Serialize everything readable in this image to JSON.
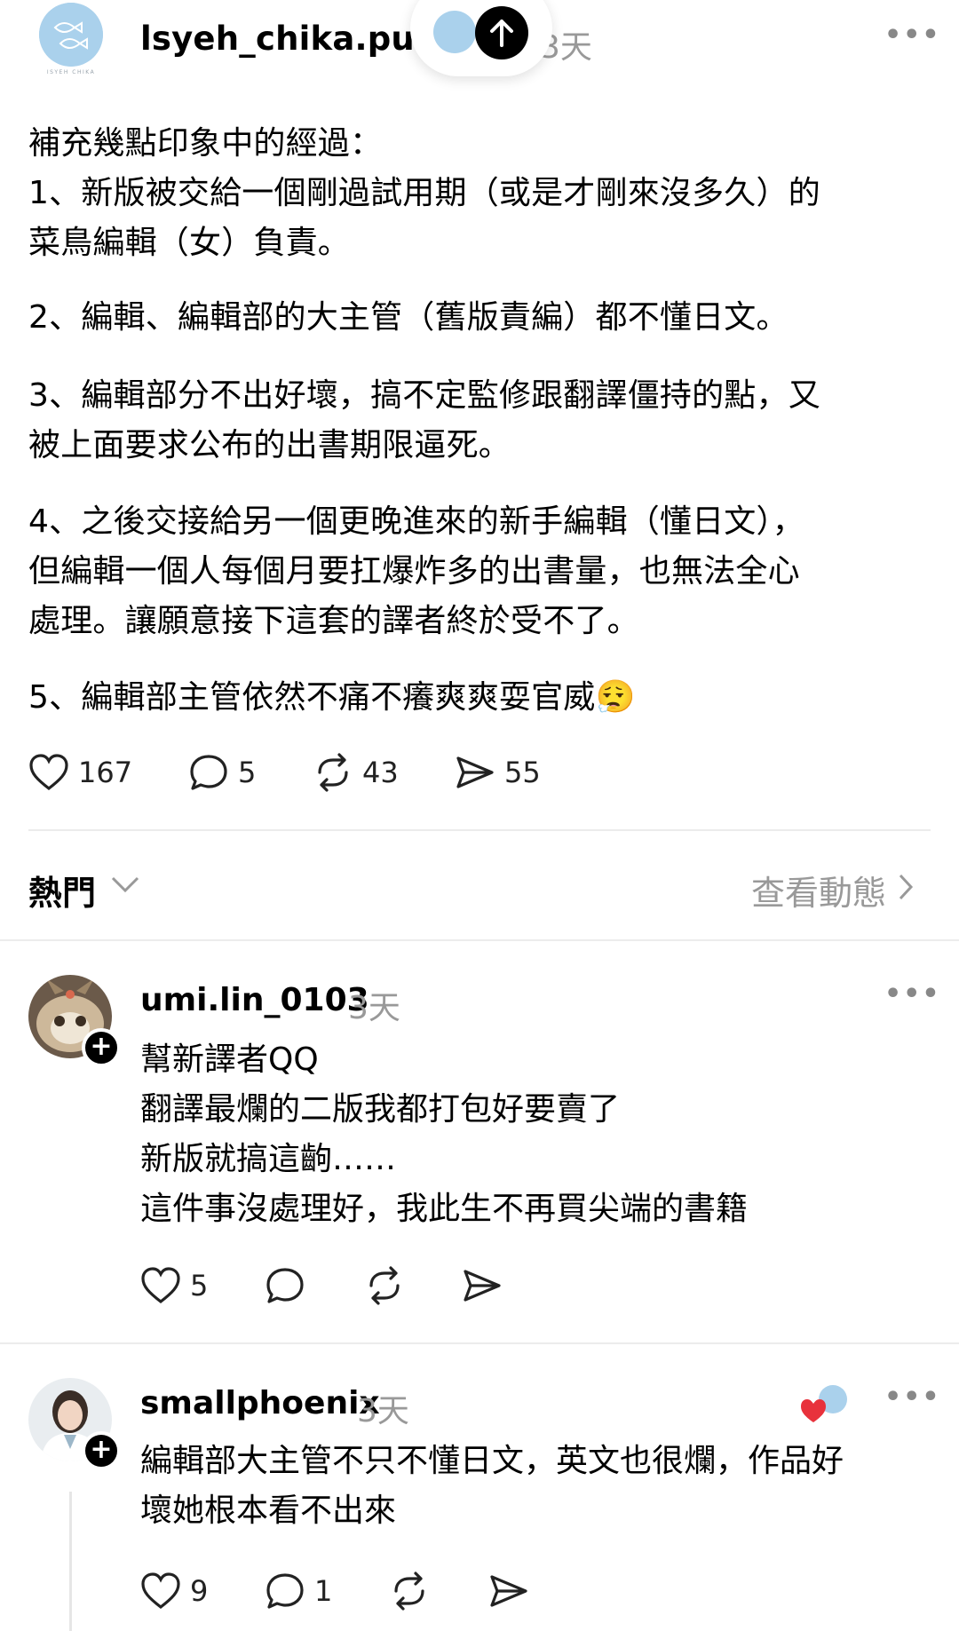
{
  "header": {
    "avatar_caption": "ISYEH CHIKA",
    "username": "lsyeh_chika.publis",
    "time": "3天",
    "more": "•••"
  },
  "post": {
    "lines": [
      "補充幾點印象中的經過：",
      "1、新版被交給一個剛過試用期（或是才剛來沒多久）的",
      "菜鳥編輯（女）負責。",
      "2、編輯、編輯部的大主管（舊版責編）都不懂日文。",
      "3、編輯部分不出好壞，搞不定監修跟翻譯僵持的點，又",
      "被上面要求公布的出書期限逼死。",
      "4、之後交接給另一個更晚進來的新手編輯（懂日文），",
      "但編輯一個人每個月要扛爆炸多的出書量，也無法全心",
      "處理。讓願意接下這套的譯者終於受不了。",
      "5、編輯部主管依然不痛不癢爽爽耍官威😮‍💨"
    ],
    "likes": "167",
    "comments": "5",
    "reposts": "43",
    "shares": "55"
  },
  "sort": {
    "label": "熱門",
    "activity_link": "查看動態"
  },
  "comments": [
    {
      "username": "umi.lin_0103",
      "time": "3天",
      "lines": [
        "幫新譯者QQ",
        "翻譯最爛的二版我都打包好要賣了",
        "新版就搞這齣……",
        "這件事沒處理好，我此生不再買尖端的書籍"
      ],
      "likes": "5",
      "replies": "",
      "more": "•••"
    },
    {
      "username": "smallphoenix",
      "time": "3天",
      "lines": [
        "編輯部大主管不只不懂日文，英文也很爛，作品好",
        "壞她根本看不出來"
      ],
      "likes": "9",
      "replies": "1",
      "more": "•••"
    }
  ],
  "colors": {
    "brand_blue": "#aad1ec",
    "muted_text": "#999999",
    "divider": "#ececec",
    "heart_red": "#e8323c"
  }
}
